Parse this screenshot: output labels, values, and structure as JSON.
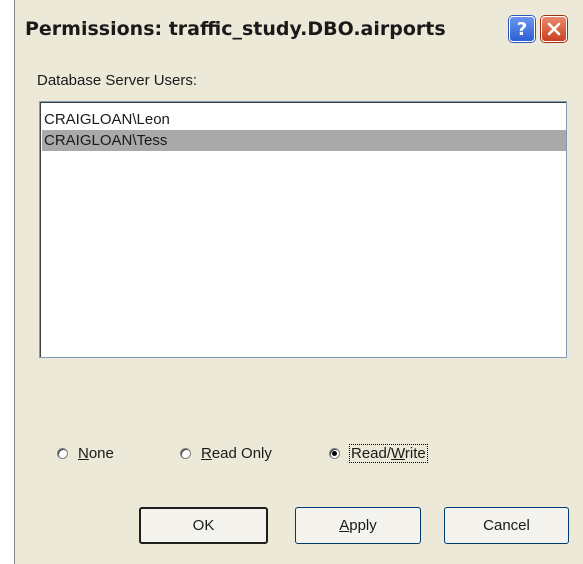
{
  "window": {
    "title": "Permissions:  traffic_study.DBO.airports",
    "help_glyph": "?",
    "close_glyph": "✕"
  },
  "users_label": "Database Server Users:",
  "users": [
    {
      "name": "CRAIGLOAN\\Leon",
      "selected": false
    },
    {
      "name": "CRAIGLOAN\\Tess",
      "selected": true
    }
  ],
  "permissions": {
    "selected": "Read/Write",
    "none_label": "None",
    "read_only_label": "Read Only",
    "read_write_label": "Read/Write"
  },
  "buttons": {
    "ok_label": "OK",
    "apply_label": "Apply",
    "cancel_label": "Cancel"
  },
  "colors": {
    "dialog_bg": "#ece9d8",
    "selection": "#a9a9a9",
    "close_button": "#c9401f",
    "help_button": "#2c5fd6"
  }
}
